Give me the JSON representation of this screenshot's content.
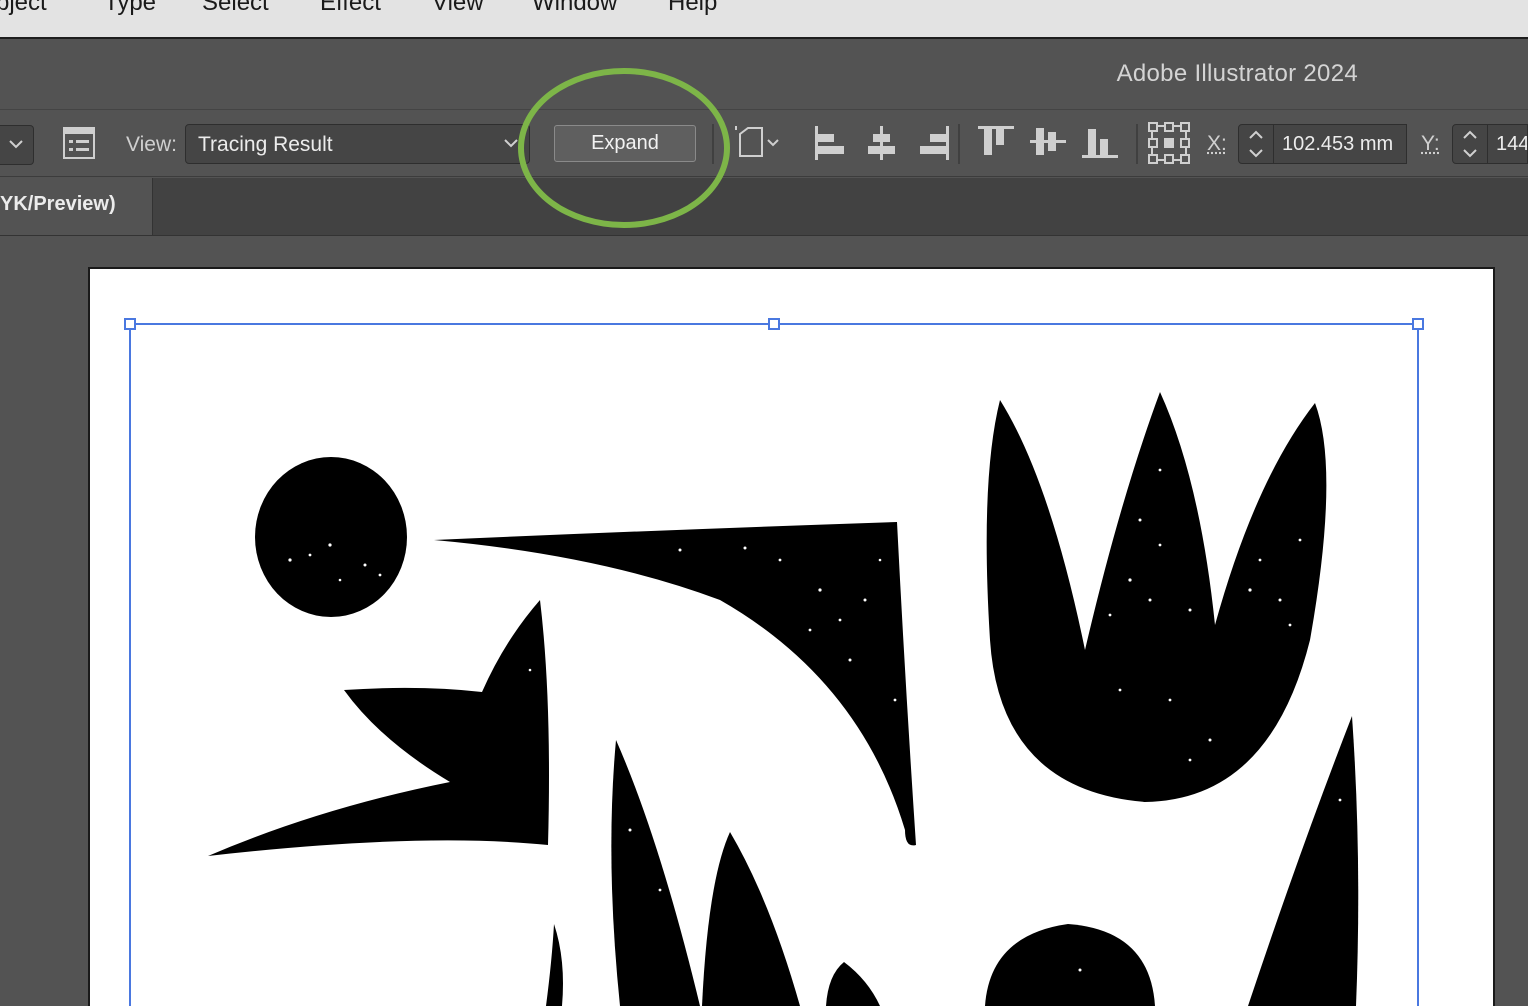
{
  "menu": {
    "items": [
      "bject",
      "Type",
      "Select",
      "Effect",
      "View",
      "Window",
      "Help"
    ]
  },
  "app": {
    "title": "Adobe Illustrator 2024"
  },
  "control_bar": {
    "view_label": "View:",
    "view_value": "Tracing Result",
    "expand_label": "Expand",
    "x_label": "X:",
    "x_value": "102.453 mm",
    "y_label": "Y:",
    "y_value": "144"
  },
  "document_tab": {
    "label": "YK/Preview)"
  },
  "colors": {
    "highlight_ring": "#7db548",
    "selection": "#4a78e0",
    "artwork_fill": "#000000"
  },
  "icons": [
    "chevron-down-icon",
    "properties-panel-icon",
    "document-setup-icon",
    "align-left-icon",
    "align-horizontal-center-icon",
    "align-right-icon",
    "align-top-icon",
    "align-vertical-center-icon",
    "align-bottom-icon",
    "reference-point-icon"
  ]
}
